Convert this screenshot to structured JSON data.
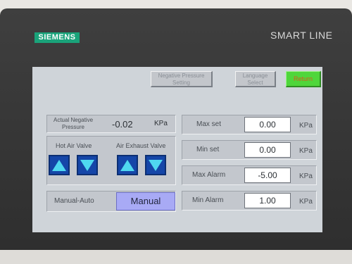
{
  "device": {
    "brand": "SIEMENS",
    "model": "SMART LINE"
  },
  "header": {
    "negative_pressure_setting": [
      "Negative Pressure",
      "Setting"
    ],
    "language_select": [
      "Language",
      "Select"
    ],
    "return_label": "Return"
  },
  "status": {
    "actual_label": [
      "Actual Negative",
      "Pressure"
    ],
    "actual_value": "-0.02",
    "actual_unit": "KPa"
  },
  "valves": {
    "hot_air_label": "Hot Air Valve",
    "exhaust_label": "Air Exhaust Valve"
  },
  "mode": {
    "label": "Manual-Auto",
    "value": "Manual"
  },
  "settings": [
    {
      "label": "Max set",
      "value": "0.00",
      "unit": "KPa"
    },
    {
      "label": "Min set",
      "value": "0.00",
      "unit": "KPa"
    },
    {
      "label": "Max Alarm",
      "value": "-5.00",
      "unit": "KPa"
    },
    {
      "label": "Min Alarm",
      "value": "1.00",
      "unit": "KPa"
    }
  ],
  "colors": {
    "return_bg": "#4fd63b",
    "arrow_bg": "#1546a8",
    "arrow_glyph": "#4fd8f0",
    "mode_bg": "#a8aaf5"
  },
  "icons": {
    "up": "arrow-up-icon",
    "down": "arrow-down-icon"
  }
}
